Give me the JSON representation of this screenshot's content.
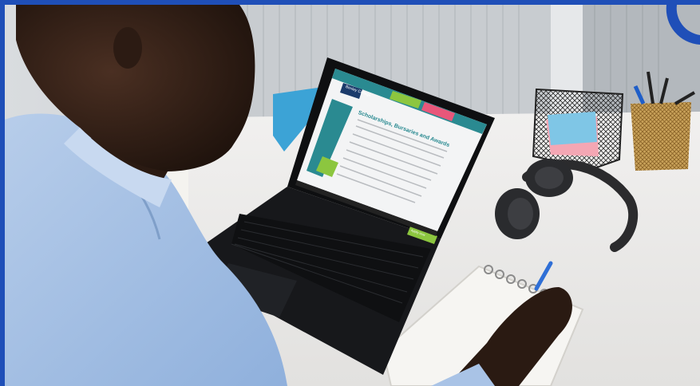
{
  "photo": {
    "subject": "student-at-laptop",
    "colors": {
      "frame_blue": "#1f4fb8",
      "desk": "#ecebea",
      "shirt": "#a9c3e6",
      "laptop": "#17181b",
      "site_teal": "#2a8a91",
      "site_green": "#8cc63f",
      "site_pink": "#e8577a"
    }
  },
  "screen_site": {
    "logo_text": "Bexley College",
    "page_heading": "Scholarships, Bursaries and Awards",
    "cta_label": "Apply now"
  }
}
